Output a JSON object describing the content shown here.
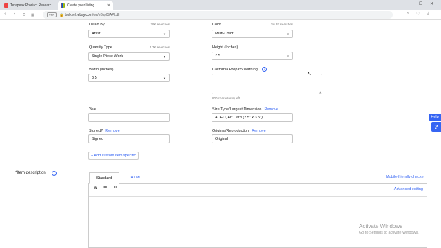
{
  "browser": {
    "tabs": [
      {
        "label": "Terapeak Product Researc..."
      },
      {
        "label": "Create your listing"
      }
    ],
    "url_prefix": "bulksell.",
    "url_domain": "ebay.com",
    "url_path": "/ws/eBayISAPI.dll",
    "badge": "VPN"
  },
  "form": {
    "listed_by": {
      "label": "Listed By",
      "count": "29K searches",
      "value": "Artist"
    },
    "color": {
      "label": "Color",
      "count": "16.3K searches",
      "value": "Multi-Color"
    },
    "quantity_type": {
      "label": "Quantity Type",
      "count": "1.7K searches",
      "value": "Single-Piece Work"
    },
    "height": {
      "label": "Height (Inches)",
      "value": "2.5"
    },
    "width": {
      "label": "Width (Inches)",
      "value": "3.5"
    },
    "prop65": {
      "label": "California Prop 65 Warning",
      "chars_left": "800  character(s) left"
    },
    "year": {
      "label": "Year",
      "value": ""
    },
    "size_type": {
      "label": "Size Type/Largest Dimension",
      "remove": "Remove",
      "value": "ACEO, Art Card (2.5\" x 3.5\")"
    },
    "signed": {
      "label": "Signed?",
      "remove": "Remove",
      "value": "Signed"
    },
    "original": {
      "label": "Original/Reproduction",
      "remove": "Remove",
      "value": "Original"
    },
    "add_custom": "+ Add custom item specific"
  },
  "description": {
    "label": "*Item description",
    "tabs": [
      "Standard",
      "HTML"
    ],
    "mobile_link": "Mobile-friendly checker",
    "advanced_link": "Advanced editing"
  },
  "help": {
    "label": "Help",
    "icon": "?"
  },
  "watermark": {
    "line1": "Activate Windows",
    "line2": "Go to Settings to activate Windows."
  }
}
